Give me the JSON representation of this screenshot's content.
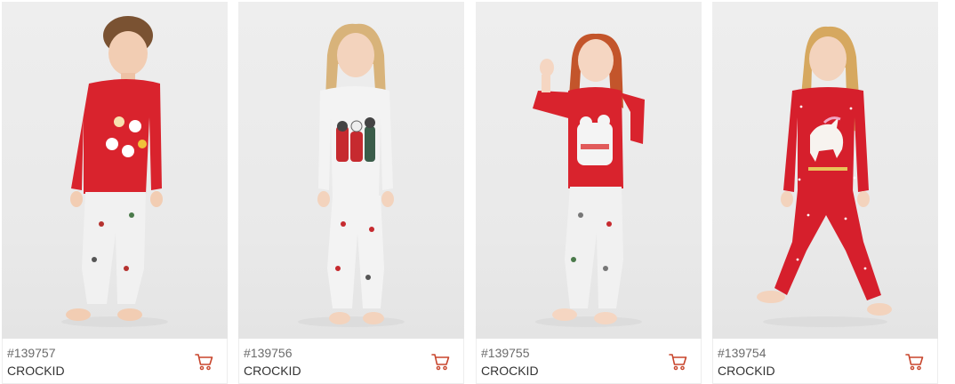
{
  "products": [
    {
      "sku": "#139757",
      "brand": "CROCKID",
      "icon": "cart-icon",
      "top_color": "#d9232d",
      "pants_color": "#f1f1f1"
    },
    {
      "sku": "#139756",
      "brand": "CROCKID",
      "icon": "cart-icon",
      "top_color": "#f3f3f3",
      "pants_color": "#f3f3f3"
    },
    {
      "sku": "#139755",
      "brand": "CROCKID",
      "icon": "cart-icon",
      "top_color": "#d9232d",
      "pants_color": "#f1f1f1"
    },
    {
      "sku": "#139754",
      "brand": "CROCKID",
      "icon": "cart-icon",
      "top_color": "#d61f2c",
      "pants_color": "#d61f2c"
    }
  ],
  "colors": {
    "accent": "#c8452c",
    "sku_text": "#6b6b6b",
    "brand_text": "#333333"
  }
}
